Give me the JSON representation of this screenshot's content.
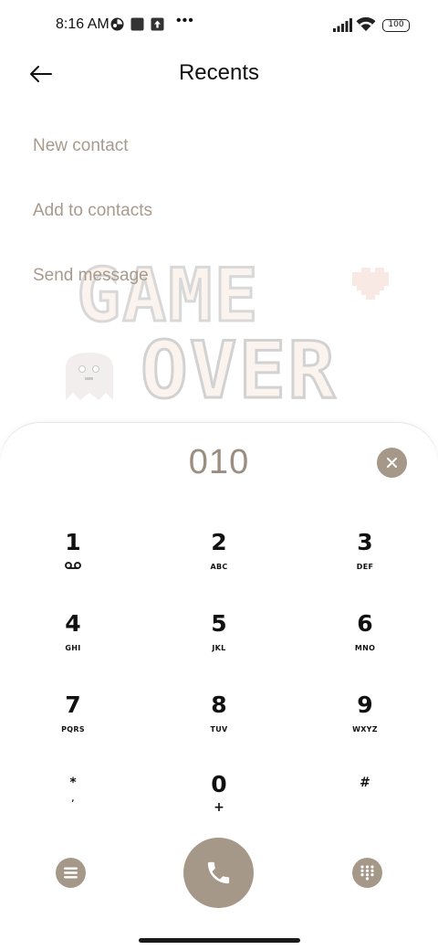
{
  "status_bar": {
    "time": "8:16 AM",
    "battery": "100",
    "icons": [
      "app-notification-icon",
      "square-notification-icon",
      "upload-notification-icon",
      "more-dots-icon",
      "signal-icon",
      "wifi-icon",
      "battery-icon"
    ]
  },
  "header": {
    "title": "Recents"
  },
  "options": {
    "new_contact": "New contact",
    "add_to_contacts": "Add to contacts",
    "send_message": "Send message"
  },
  "dialer": {
    "number": "010",
    "keys": [
      {
        "digit": "1",
        "sub": ""
      },
      {
        "digit": "2",
        "sub": "ABC"
      },
      {
        "digit": "3",
        "sub": "DEF"
      },
      {
        "digit": "4",
        "sub": "GHI"
      },
      {
        "digit": "5",
        "sub": "JKL"
      },
      {
        "digit": "6",
        "sub": "MNO"
      },
      {
        "digit": "7",
        "sub": "PQRS"
      },
      {
        "digit": "8",
        "sub": "TUV"
      },
      {
        "digit": "9",
        "sub": "WXYZ"
      },
      {
        "digit": "*",
        "sub": ","
      },
      {
        "digit": "0",
        "sub": "+"
      },
      {
        "digit": "#",
        "sub": ""
      }
    ]
  },
  "colors": {
    "accent": "#a69888",
    "option_text": "#a89a8c",
    "number_text": "#9b8d80"
  }
}
